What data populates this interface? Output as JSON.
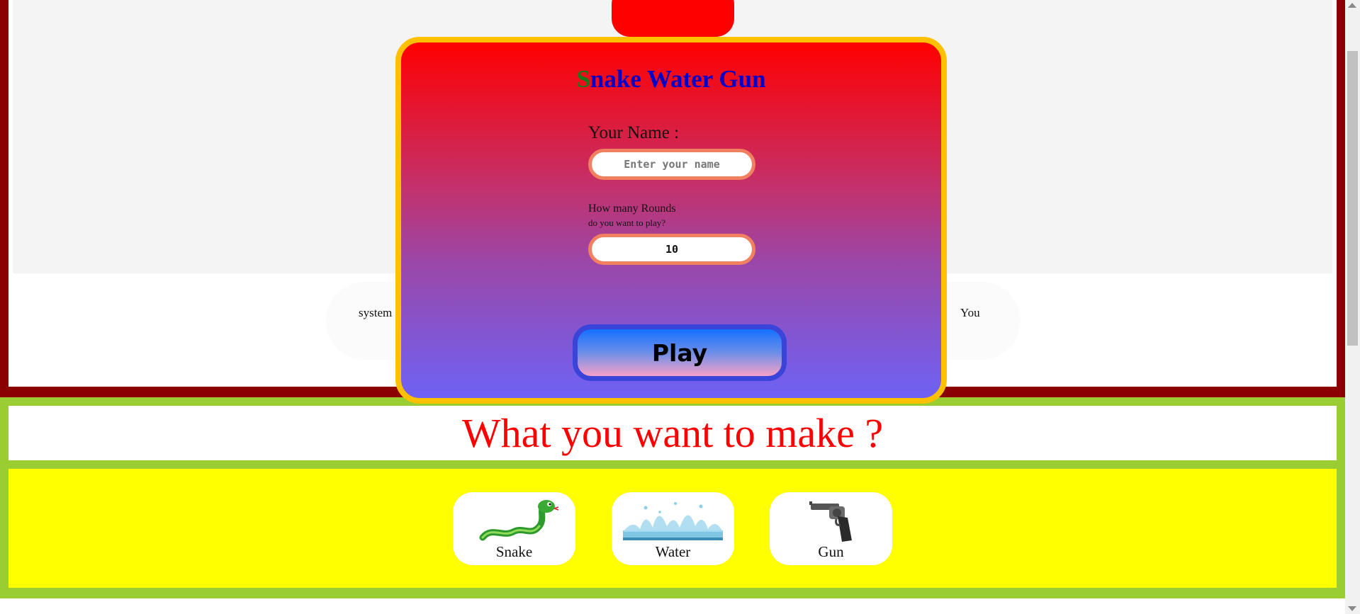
{
  "game": {
    "system_label": "system",
    "you_label": "You"
  },
  "question": "What you want to make ?",
  "choices": [
    {
      "label": "Snake",
      "icon": "snake-icon"
    },
    {
      "label": "Water",
      "icon": "water-splash-icon"
    },
    {
      "label": "Gun",
      "icon": "revolver-icon"
    }
  ],
  "modal": {
    "title_first": "S",
    "title_rest": "nake Water Gun",
    "name_label": "Your Name :",
    "name_placeholder": "Enter your name",
    "name_value": "",
    "rounds_label": "How many Rounds",
    "rounds_sub": "do you want to play?",
    "rounds_value": "10",
    "play_label": "Play"
  },
  "colors": {
    "modal_border": "#ffc000",
    "modal_gradient_top": "#ff0000",
    "modal_gradient_bottom": "#6e62f5",
    "question_text": "#ff0000",
    "choices_background": "#ffff00",
    "frame_green": "#9acd32",
    "frame_dark_red": "#8b0000"
  }
}
